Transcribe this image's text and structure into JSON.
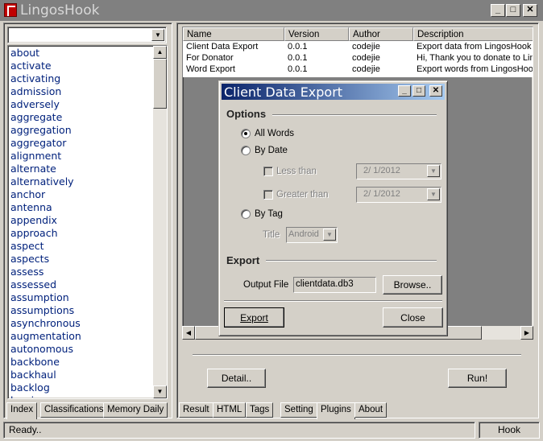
{
  "window": {
    "title": "LingosHook",
    "minimize": "_",
    "maximize": "□",
    "close": "✕"
  },
  "left": {
    "combo_value": "",
    "words": [
      "about",
      "activate",
      "activating",
      "admission",
      "adversely",
      "aggregate",
      "aggregation",
      "aggregator",
      "alignment",
      "alternate",
      "alternatively",
      "anchor",
      "antenna",
      "appendix",
      "approach",
      "aspect",
      "aspects",
      "assess",
      "assessed",
      "assumption",
      "assumptions",
      "asynchronous",
      "augmentation",
      "autonomous",
      "backbone",
      "backhaul",
      "backlog",
      "barrier"
    ],
    "tabs": [
      "Index",
      "Classifications",
      "Memory Daily"
    ],
    "active_tab": "Index"
  },
  "plugins": {
    "columns": [
      "Name",
      "Version",
      "Author",
      "Description"
    ],
    "rows": [
      {
        "name": "Client Data Export",
        "version": "0.0.1",
        "author": "codejie",
        "description": "Export data from LingosHook"
      },
      {
        "name": "For Donator",
        "version": "0.0.1",
        "author": "codejie",
        "description": "Hi, Thank you to donate to LingosHook"
      },
      {
        "name": "Word Export",
        "version": "0.0.1",
        "author": "codejie",
        "description": "Export words from LingosHook"
      }
    ],
    "detail_label": "Detail..",
    "run_label": "Run!"
  },
  "right_tabs": [
    "Result",
    "HTML",
    "Tags",
    "Setting",
    "Plugins",
    "About"
  ],
  "active_right_tab": "Plugins",
  "status": {
    "text": "Ready..",
    "hook": "Hook"
  },
  "dialog": {
    "title": "Client Data Export",
    "options_label": "Options",
    "all_words": "All Words",
    "by_date": "By Date",
    "less_than": "Less than",
    "less_than_date": "2/  1/2012",
    "greater_than": "Greater than",
    "greater_than_date": "2/  1/2012",
    "by_tag": "By Tag",
    "title_label": "Title",
    "title_value": "Android",
    "export_group": "Export",
    "output_file_label": "Output File",
    "output_file_value": "clientdata.db3",
    "browse_label": "Browse..",
    "export_button": "Export",
    "close_button": "Close"
  }
}
